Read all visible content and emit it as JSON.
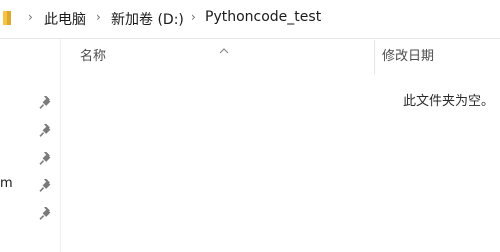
{
  "breadcrumb": {
    "items": [
      {
        "label": "此电脑"
      },
      {
        "label": "新加卷 (D:)"
      },
      {
        "label": "Pythoncode_test"
      }
    ]
  },
  "nav_pane": {
    "truncated_item_text": "m",
    "pinned_count": 5
  },
  "file_list": {
    "columns": [
      {
        "label": "名称",
        "sorted": "ascending"
      },
      {
        "label": "修改日期"
      }
    ],
    "empty_message": "此文件夹为空。"
  },
  "colors": {
    "folder": "#f6c343",
    "folder_dark": "#dca92c",
    "pin": "#7a7a7a",
    "separator": "#6b6b6b"
  },
  "icons": [
    "folder-icon",
    "chevron-right-icon",
    "pin-icon",
    "sort-caret-icon"
  ]
}
